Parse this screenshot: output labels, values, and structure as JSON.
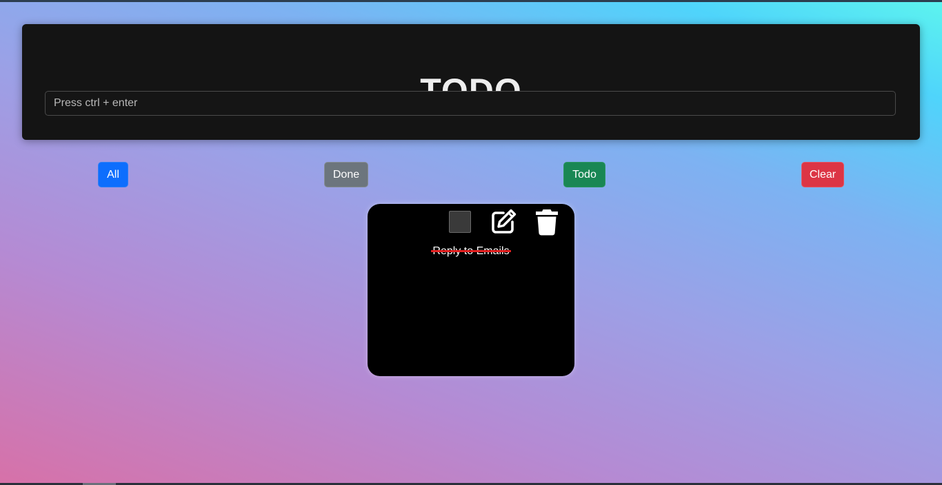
{
  "header": {
    "title": "TODO",
    "input_placeholder": "Press ctrl + enter"
  },
  "filters": {
    "all_label": "All",
    "done_label": "Done",
    "todo_label": "Todo",
    "clear_label": "Clear"
  },
  "tasks": [
    {
      "text": "Reply to Emails",
      "completed": true,
      "edit_icon": "edit-icon",
      "delete_icon": "trash-icon"
    }
  ],
  "colors": {
    "all_button": "#0d6efd",
    "done_button": "#6c757d",
    "todo_button": "#198754",
    "clear_button": "#dc3545",
    "strike_line": "#e32020"
  }
}
